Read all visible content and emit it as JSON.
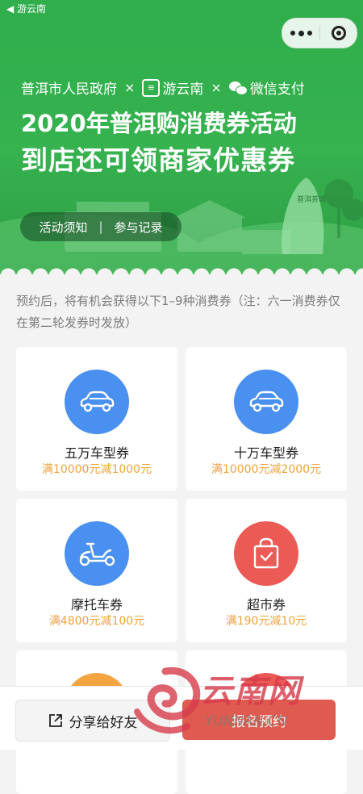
{
  "statusbar": {
    "back_app": "◀ 游云南"
  },
  "capsule": {
    "more_icon": "more-dots",
    "close_icon": "target-circle"
  },
  "hero": {
    "partner1": "普洱市人民政府",
    "partner2": "游云南",
    "partner3": "微信支付",
    "separator": "×",
    "title_line1": "2020年普洱购消费券活动",
    "title_line2": "到店还可领商家优惠券",
    "stone_text": "普洱茶城",
    "tab_notice": "活动须知",
    "tab_divider": "|",
    "tab_records": "参与记录",
    "colors": {
      "green": "#36b24f",
      "dark_green": "#2e9e45"
    }
  },
  "description": "预约后，将有机会获得以下1–9种消费券（注：六一消费券仅在第二轮发券时发放）",
  "coupons": [
    {
      "name": "五万车型券",
      "condition": "满10000元减1000元",
      "icon": "car-icon",
      "color": "#4a90f0"
    },
    {
      "name": "十万车型券",
      "condition": "满10000元减2000元",
      "icon": "car-icon",
      "color": "#4a90f0"
    },
    {
      "name": "摩托车券",
      "condition": "满4800元减100元",
      "icon": "scooter-icon",
      "color": "#4a90f0"
    },
    {
      "name": "超市券",
      "condition": "满190元减10元",
      "icon": "shopping-bag-icon",
      "color": "#ec5a55"
    },
    {
      "name": "",
      "condition": "",
      "icon": "",
      "color": "#f5a442"
    },
    {
      "name": "",
      "condition": "",
      "icon": "",
      "color": "#ec5a55"
    }
  ],
  "bottom": {
    "share_label": "分享给好友",
    "share_icon": "share-icon",
    "reserve_label": "报名预约",
    "reserve_color": "#e05b4f"
  },
  "watermark": {
    "logo_text": "云南网",
    "url_text": "YUNNAN.CN"
  }
}
